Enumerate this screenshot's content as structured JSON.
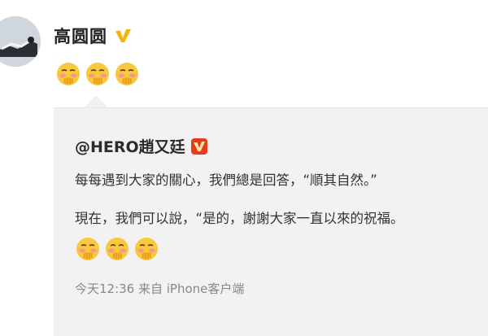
{
  "post": {
    "author": "高圆圆",
    "emoji_icons": [
      "shy-face-icon",
      "shy-face-icon",
      "shy-face-icon"
    ]
  },
  "repost": {
    "mention": "@HERO趙又廷",
    "line1": "每每遇到大家的關心，我們總是回答，“順其自然。”",
    "line2": "現在，我們可以說，“是的，謝謝大家一直以來的祝福。",
    "emoji_icons": [
      "shy-face-icon",
      "shy-face-icon",
      "shy-face-icon"
    ],
    "meta": "今天12:36 来自 iPhone客户端"
  },
  "colors": {
    "verified_gold": "#f2b311",
    "verified_red": "#e83a1c",
    "repost_bg": "#f2f2f5"
  }
}
